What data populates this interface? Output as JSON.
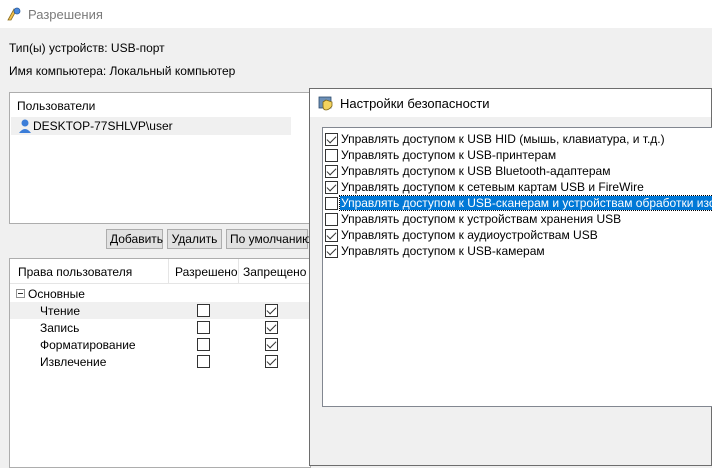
{
  "window": {
    "title": "Разрешения",
    "device_type": "Тип(ы) устройств: USB-порт",
    "computer_name": "Имя компьютера: Локальный компьютер"
  },
  "users": {
    "header": "Пользователи",
    "items": [
      {
        "name": "DESKTOP-77SHLVP\\user"
      }
    ]
  },
  "buttons": {
    "add": "Добавить",
    "remove": "Удалить",
    "default": "По умолчанию"
  },
  "permissions": {
    "headers": {
      "name": "Права пользователя",
      "allowed": "Разрешено",
      "denied": "Запрещено"
    },
    "group": "Основные",
    "rows": [
      {
        "label": "Чтение",
        "allowed": false,
        "denied": true
      },
      {
        "label": "Запись",
        "allowed": false,
        "denied": true
      },
      {
        "label": "Форматирование",
        "allowed": false,
        "denied": true
      },
      {
        "label": "Извлечение",
        "allowed": false,
        "denied": true
      }
    ]
  },
  "dialog": {
    "title": "Настройки безопасности",
    "options": [
      {
        "label": "Управлять доступом к USB HID (мышь, клавиатура, и т.д.)",
        "checked": true,
        "selected": false
      },
      {
        "label": "Управлять доступом к USB-принтерам",
        "checked": false,
        "selected": false
      },
      {
        "label": "Управлять доступом к USB Bluetooth-адаптерам",
        "checked": true,
        "selected": false
      },
      {
        "label": "Управлять доступом к сетевым картам USB и FireWire",
        "checked": true,
        "selected": false
      },
      {
        "label": "Управлять доступом к USB-сканерам и устройствам обработки изображений",
        "checked": false,
        "selected": true
      },
      {
        "label": "Управлять доступом к устройствам хранения USB",
        "checked": false,
        "selected": false
      },
      {
        "label": "Управлять доступом к аудиоустройствам USB",
        "checked": true,
        "selected": false
      },
      {
        "label": "Управлять доступом к USB-камерам",
        "checked": true,
        "selected": false
      }
    ]
  },
  "colors": {
    "selection": "#0078d7",
    "window_bg": "#f0f0f0"
  }
}
